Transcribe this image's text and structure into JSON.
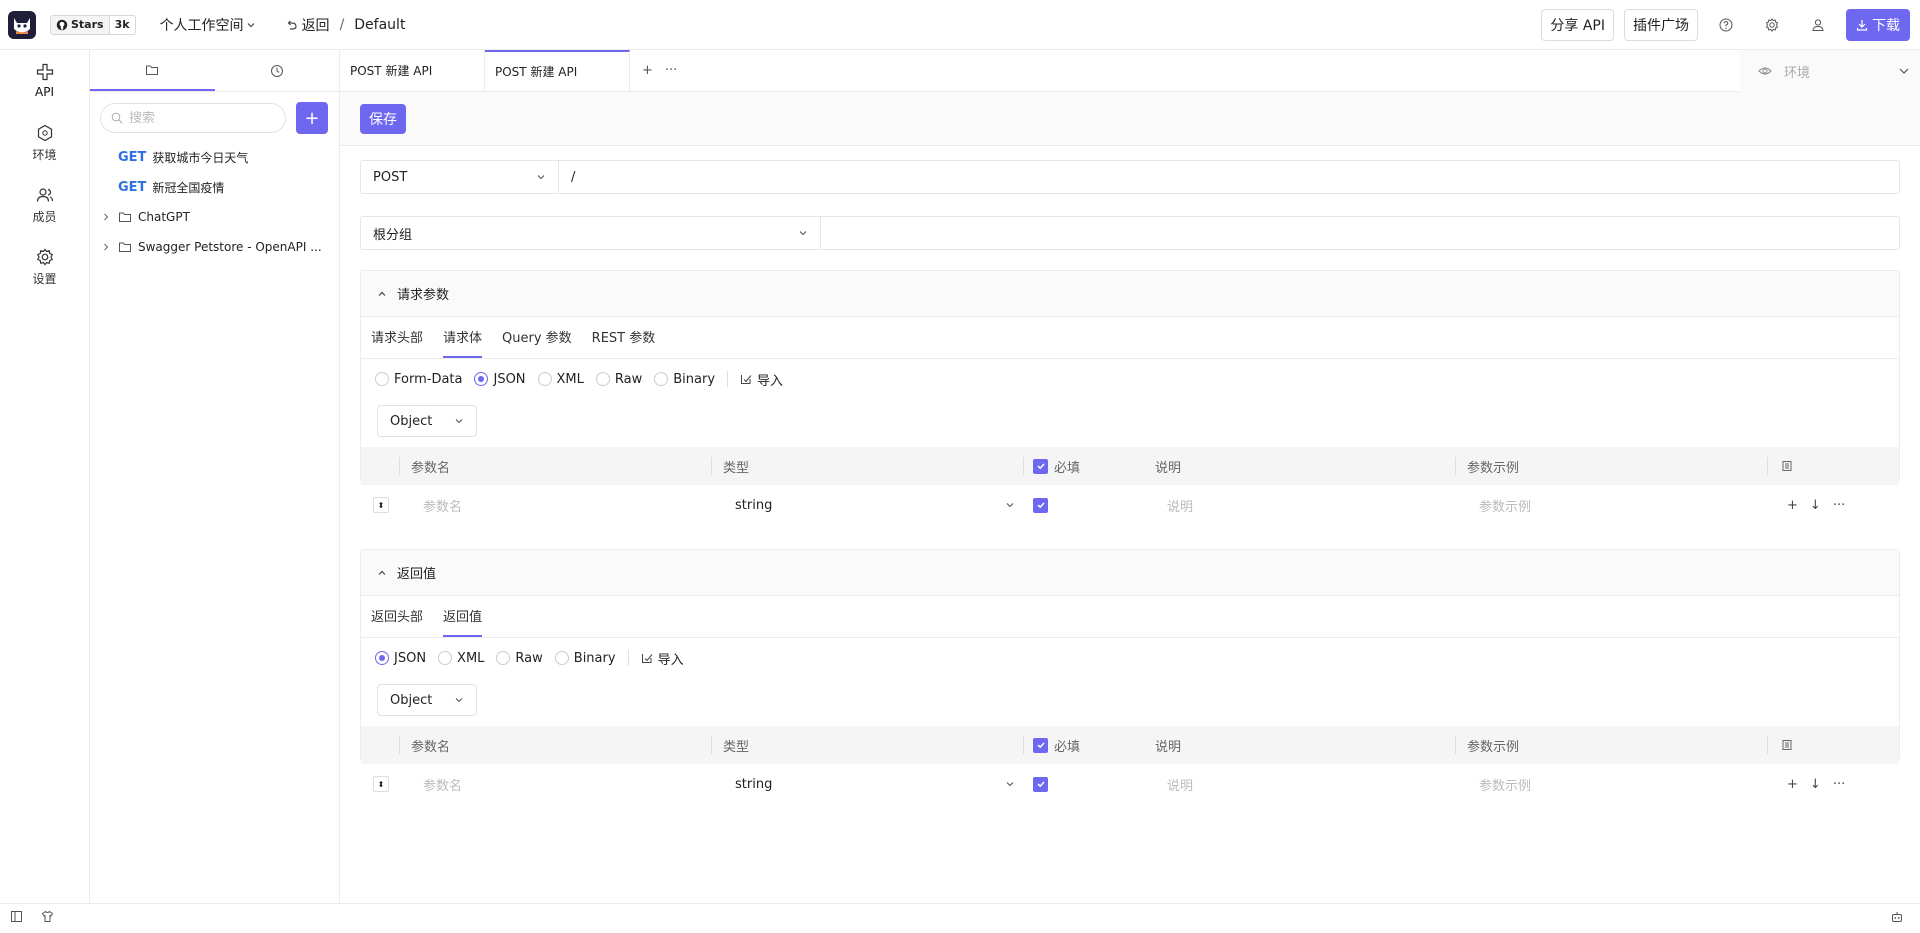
{
  "header": {
    "stars_label": "Stars",
    "stars_count": "3k",
    "workspace": "个人工作空间",
    "back": "返回",
    "crumb_sep": "/",
    "project": "Default",
    "share_api": "分享 API",
    "plugins": "插件广场",
    "download": "下载",
    "accent_color": "#6e67f0"
  },
  "rail": {
    "items": [
      {
        "label": "API",
        "icon": "api-icon"
      },
      {
        "label": "环境",
        "icon": "environment-icon"
      },
      {
        "label": "成员",
        "icon": "members-icon"
      },
      {
        "label": "设置",
        "icon": "settings-icon"
      }
    ]
  },
  "tree": {
    "search_placeholder": "搜索",
    "items": [
      {
        "method": "GET",
        "label": "获取城市今日天气"
      },
      {
        "method": "GET",
        "label": "新冠全国疫情"
      },
      {
        "label": "ChatGPT"
      },
      {
        "label": "Swagger Petstore - OpenAPI ..."
      }
    ]
  },
  "tabs": [
    {
      "label": "POST 新建 API"
    },
    {
      "label": "POST 新建 API"
    }
  ],
  "tab_controls": {
    "add": "+",
    "more": "···"
  },
  "env": {
    "placeholder": "环境"
  },
  "save": "保存",
  "request": {
    "method": "POST",
    "url": "/",
    "group": "根分组"
  },
  "params_section": {
    "title": "请求参数",
    "tabs": [
      "请求头部",
      "请求体",
      "Query 参数",
      "REST 参数"
    ],
    "active_tab": 1,
    "body_types": [
      "Form-Data",
      "JSON",
      "XML",
      "Raw",
      "Binary"
    ],
    "checked_type": "JSON",
    "import": "导入",
    "root_type": "Object",
    "columns": {
      "name": "参数名",
      "type": "类型",
      "required": "必填",
      "desc": "说明",
      "example": "参数示例"
    },
    "row": {
      "name_ph": "参数名",
      "type": "string",
      "desc_ph": "说明",
      "example_ph": "参数示例"
    }
  },
  "response_section": {
    "title": "返回值",
    "tabs": [
      "返回头部",
      "返回值"
    ],
    "active_tab": 1,
    "body_types": [
      "JSON",
      "XML",
      "Raw",
      "Binary"
    ],
    "checked_type": "JSON",
    "import": "导入",
    "root_type": "Object",
    "columns": {
      "name": "参数名",
      "type": "类型",
      "required": "必填",
      "desc": "说明",
      "example": "参数示例"
    },
    "row": {
      "name_ph": "参数名",
      "type": "string",
      "desc_ph": "说明",
      "example_ph": "参数示例"
    }
  }
}
